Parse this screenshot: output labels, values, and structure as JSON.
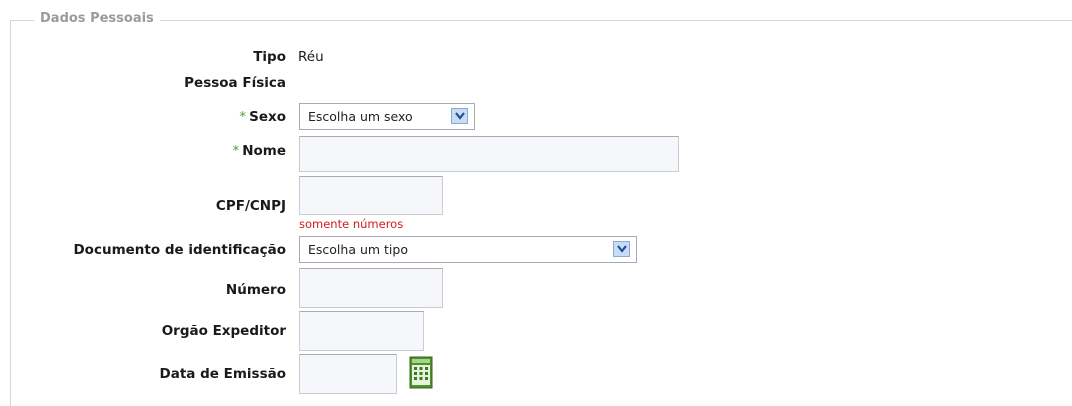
{
  "fieldset": {
    "legend": "Dados Pessoais"
  },
  "tipo": {
    "label": "Tipo",
    "value": "Réu"
  },
  "pessoa": {
    "label": "Pessoa Física"
  },
  "sexo": {
    "label": "Sexo",
    "selected": "Escolha um sexo"
  },
  "nome": {
    "label": "Nome",
    "value": ""
  },
  "cpf": {
    "label": "CPF/CNPJ",
    "value": "",
    "hint": "somente números"
  },
  "documento": {
    "label": "Documento de identificação",
    "selected": "Escolha um tipo"
  },
  "numero": {
    "label": "Número",
    "value": ""
  },
  "orgao": {
    "label": "Orgão Expeditor",
    "value": ""
  },
  "data_emissao": {
    "label": "Data de Emissão",
    "value": ""
  },
  "required_marker": "*",
  "colors": {
    "required": "#5a9a3a",
    "hint": "#d31a1a",
    "legend": "#9b9b9b"
  },
  "icons": {
    "calendar": "calendar-icon",
    "dropdown": "chevron-down-icon"
  }
}
